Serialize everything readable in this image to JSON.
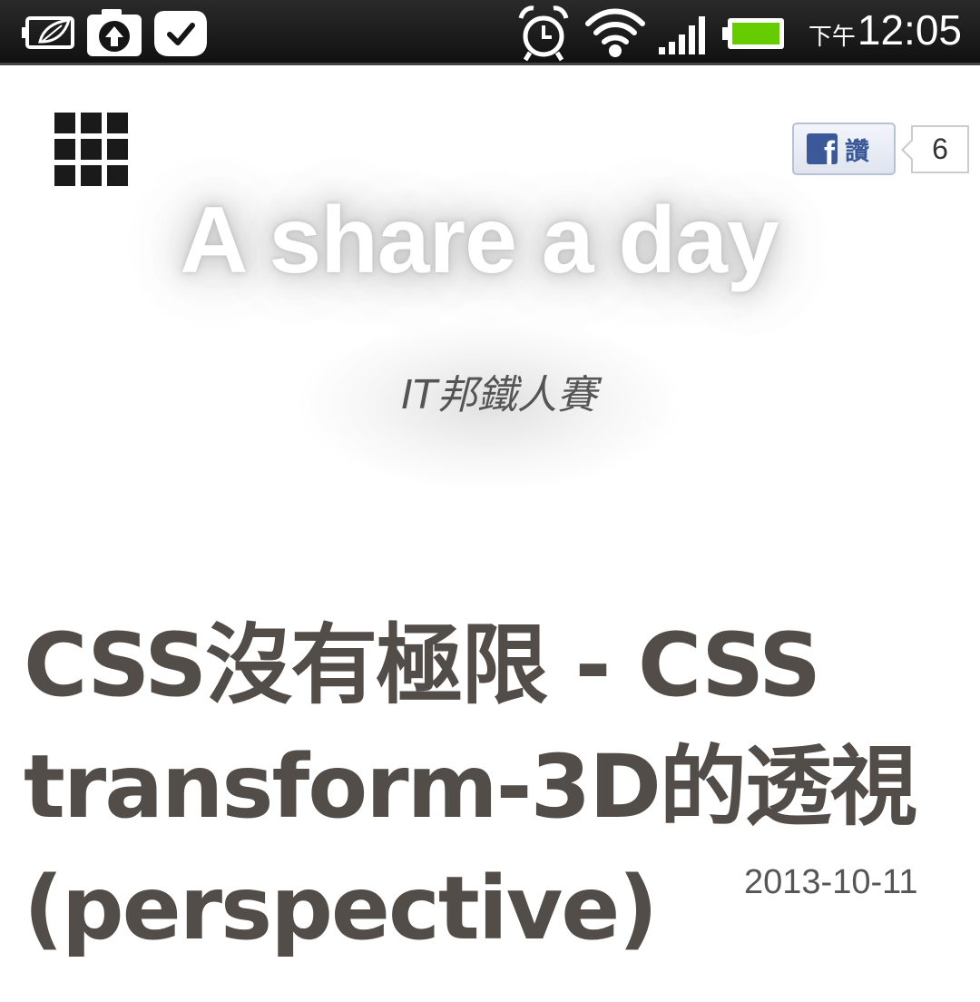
{
  "status_bar": {
    "left_icons": [
      "battery-leaf-icon",
      "camera-upload-icon",
      "checkmark-bubble-icon"
    ],
    "right_icons": [
      "alarm-icon",
      "wifi-icon",
      "signal-icon",
      "battery-icon"
    ],
    "battery_color": "#66cc00",
    "am_pm": "下午",
    "time": "12:05"
  },
  "header": {
    "menu_icon": "grid-menu-icon",
    "site_title": "A share a day",
    "site_subtitle": "IT邦鐵人賽",
    "facebook": {
      "logo_letter": "f",
      "like_label": "讚",
      "like_count": "6",
      "brand_color": "#3b5998"
    }
  },
  "article": {
    "title": "CSS沒有極限 - CSS transform-3D的透視(perspective)",
    "date": "2013-10-11",
    "title_color": "#524d48"
  }
}
